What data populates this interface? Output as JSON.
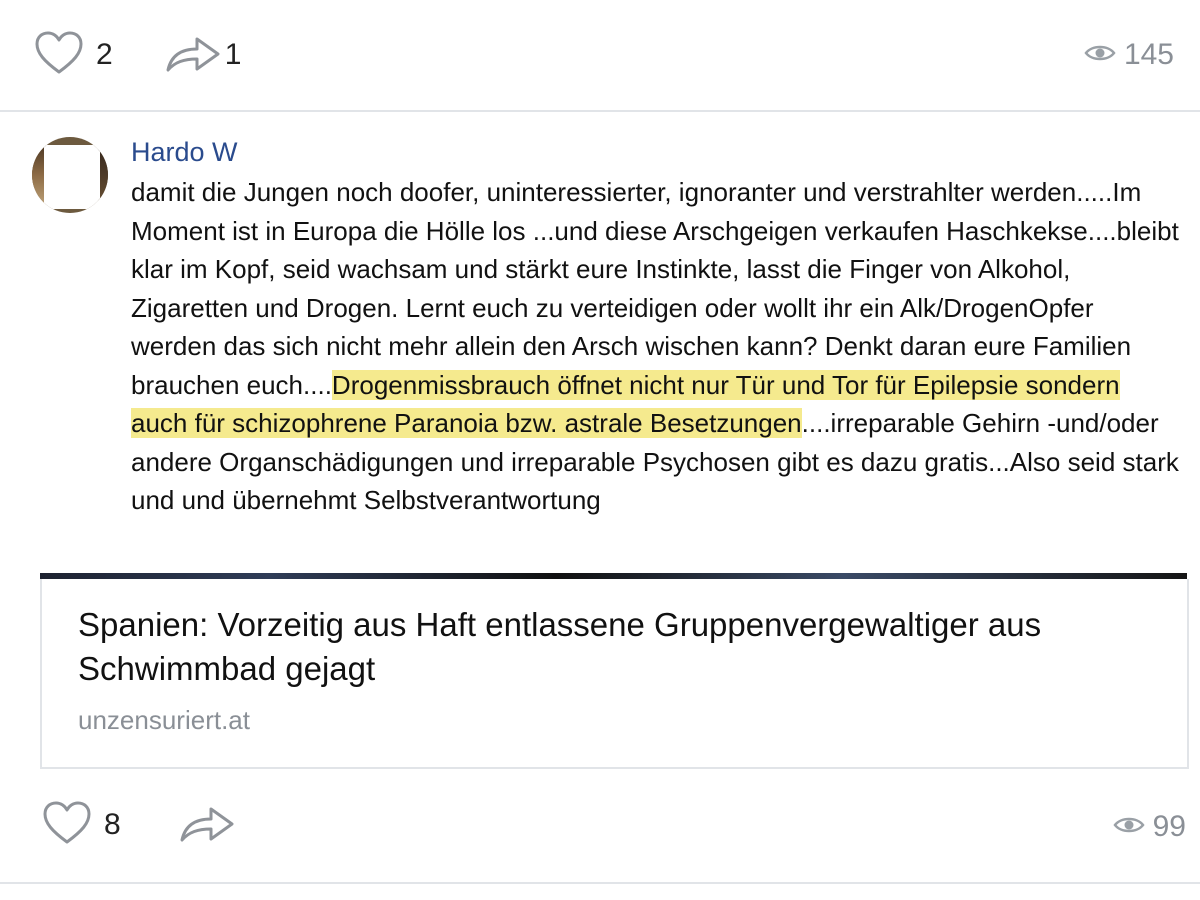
{
  "post_top": {
    "like_count": "2",
    "share_count": "1",
    "view_count": "145"
  },
  "comment": {
    "author": "Hardo W",
    "text_before": "damit die Jungen noch doofer, uninteressierter, ignoranter und verstrahlter werden.....Im Moment ist in Europa die Hölle los ...und diese Arschgeigen verkaufen Haschkekse....bleibt klar im Kopf, seid wachsam und stärkt eure Instinkte, lasst die Finger von Alkohol, Zigaretten und Drogen. Lernt euch zu verteidigen oder wollt ihr ein Alk/DrogenOpfer werden das sich nicht mehr allein den Arsch wischen kann? Denkt daran eure Familien brauchen euch....",
    "text_highlighted": "Drogenmissbrauch öffnet nicht nur Tür und Tor für Epilepsie sondern auch für schizophrene Paranoia bzw. astrale Besetzungen",
    "text_after": "....irreparable Gehirn -und/oder andere Organschädigungen und irreparable Psychosen gibt es dazu gratis...Also seid stark und und übernehmt Selbstverantwortung"
  },
  "link_preview": {
    "title": "Spanien: Vorzeitig aus Haft entlassene Gruppenvergewaltiger aus Schwimmbad gejagt",
    "domain": "unzensuriert.at"
  },
  "post_bottom": {
    "like_count": "8",
    "view_count": "99"
  },
  "colors": {
    "highlight": "#f5ea8e",
    "author_link": "#2a4b8d",
    "muted": "#8a8f96",
    "icon_stroke": "#8f9399"
  }
}
